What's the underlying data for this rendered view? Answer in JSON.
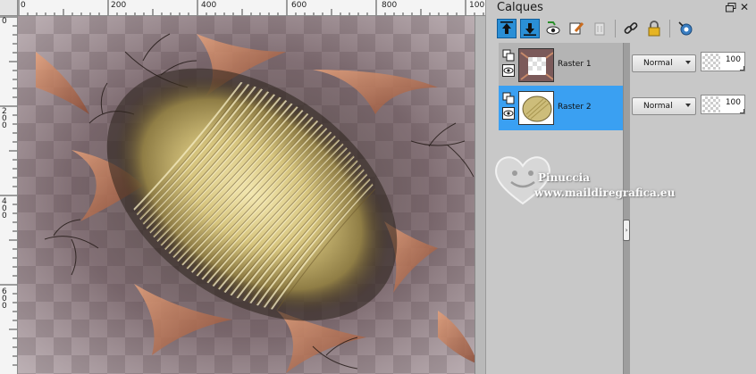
{
  "rulers": {
    "top_labels": [
      "0",
      "200",
      "400",
      "600",
      "800",
      "100"
    ],
    "left_labels": [
      "0",
      "2\n0\n0",
      "4\n0\n0",
      "6\n0\n0"
    ]
  },
  "palette": {
    "title": "Calques",
    "toolbar_icons": [
      "move-layer-up-icon",
      "move-layer-down-icon",
      "layer-visibility-icon",
      "edit-layer-icon",
      "delete-layer-icon",
      "link-layer-icon",
      "lock-layer-icon",
      "layer-effects-icon"
    ],
    "layers": [
      {
        "name": "Raster 1",
        "blend_mode": "Normal",
        "opacity": "100",
        "selected": false
      },
      {
        "name": "Raster 2",
        "blend_mode": "Normal",
        "opacity": "100",
        "selected": true
      }
    ]
  },
  "watermark": {
    "name": "Pinuccia",
    "url": "www.maildiregrafica.eu"
  },
  "colors": {
    "selection": "#3aa0f2",
    "active_tool": "#2a8fd6",
    "panel_bg": "#c8c8c8",
    "art_gold": "#d8c78a",
    "art_mauve": "#6b4f55"
  }
}
